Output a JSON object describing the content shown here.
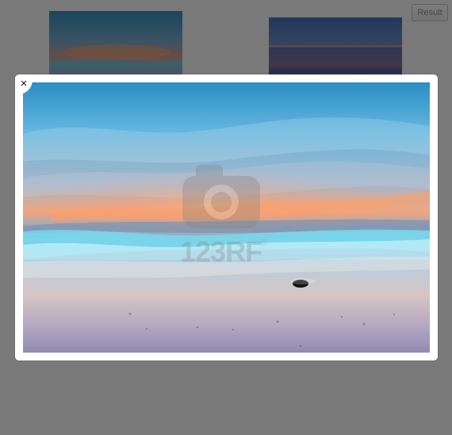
{
  "toolbar": {
    "result_label": "Result"
  },
  "modal": {
    "close_label": "×",
    "watermark_text": "123RF",
    "watermark_registered": "®"
  },
  "icons": {
    "close": "close-icon",
    "camera_watermark": "camera-icon"
  }
}
